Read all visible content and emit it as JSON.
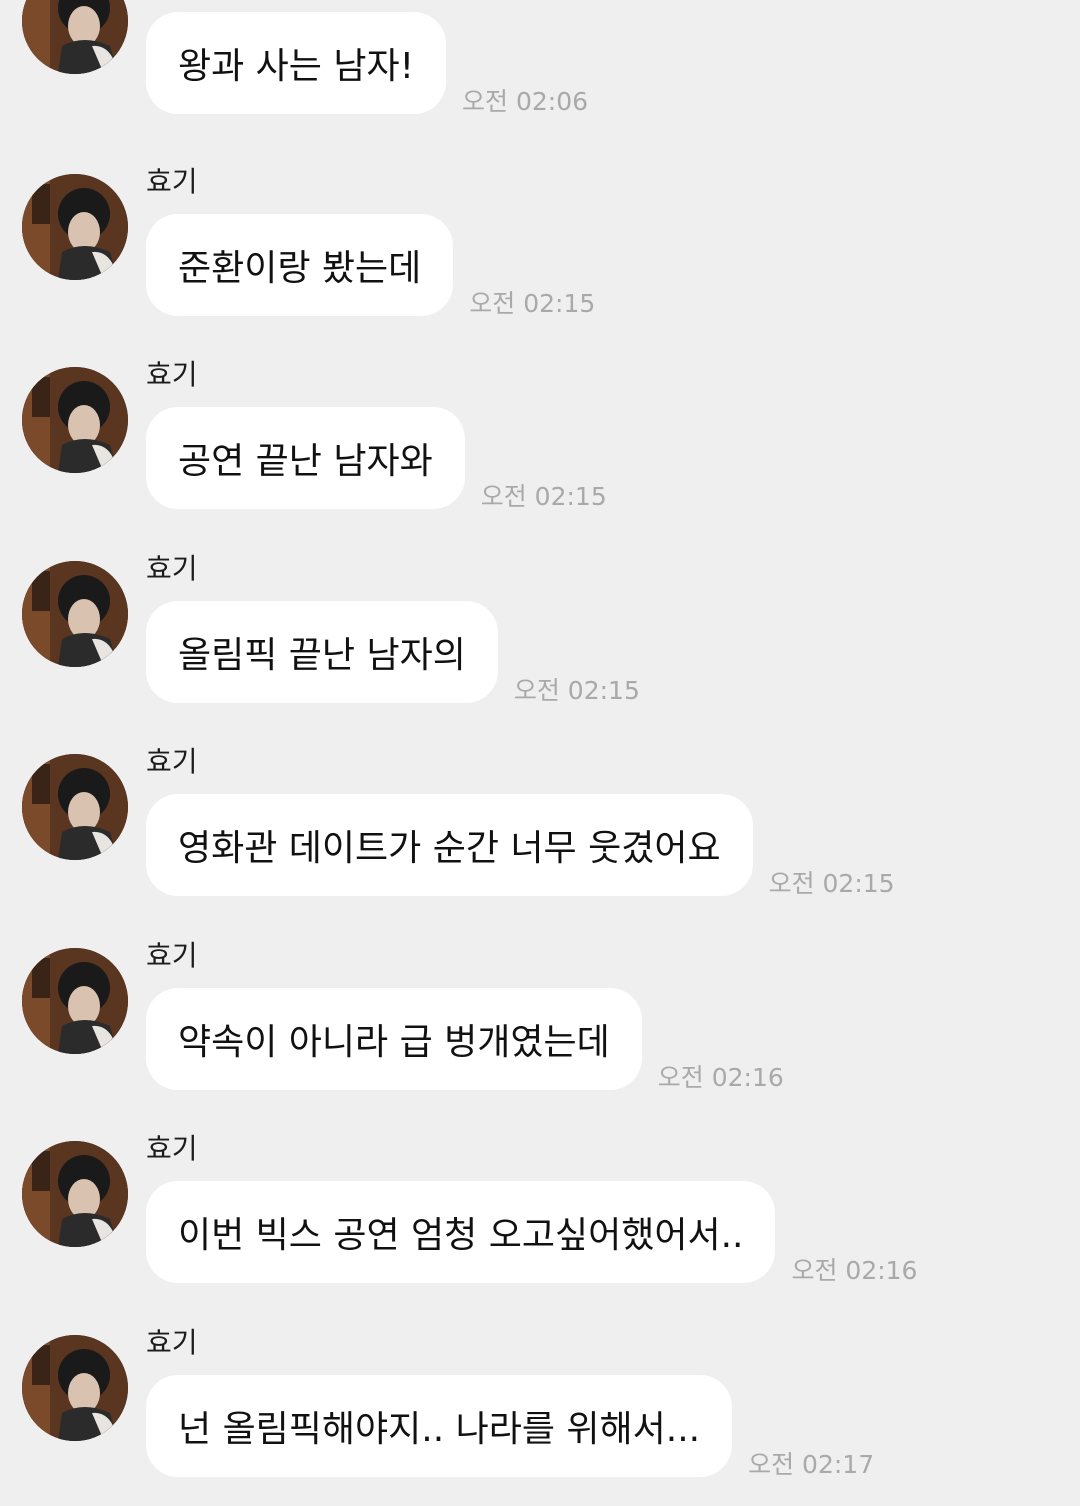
{
  "messages": [
    {
      "sender": "",
      "text": "왕과 사는 남자!",
      "time": "오전 02:06"
    },
    {
      "sender": "효기",
      "text": "준환이랑 봤는데",
      "time": "오전 02:15"
    },
    {
      "sender": "효기",
      "text": "공연 끝난 남자와",
      "time": "오전 02:15"
    },
    {
      "sender": "효기",
      "text": "올림픽 끝난 남자의",
      "time": "오전 02:15"
    },
    {
      "sender": "효기",
      "text": "영화관 데이트가 순간 너무 웃겼어요",
      "time": "오전 02:15"
    },
    {
      "sender": "효기",
      "text": "약속이 아니라 급 벙개였는데",
      "time": "오전 02:16"
    },
    {
      "sender": "효기",
      "text": "이번 빅스 공연 엄청 오고싶어했어서..",
      "time": "오전 02:16"
    },
    {
      "sender": "효기",
      "text": "넌 올림픽해야지.. 나라를 위해서...",
      "time": "오전 02:17"
    }
  ],
  "colors": {
    "background": "#efefef",
    "bubble": "#ffffff",
    "timestamp": "#a9a9a9",
    "text": "#111111"
  },
  "icons": {
    "avatar": "profile-photo-avatar"
  }
}
